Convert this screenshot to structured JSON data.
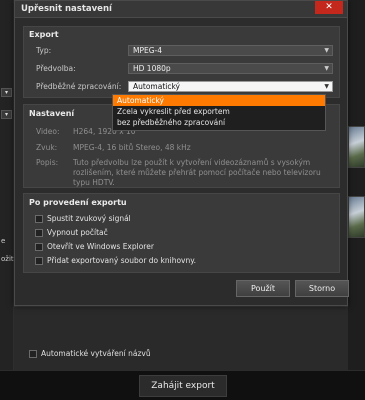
{
  "dialog": {
    "title": "Upřesnit nastavení",
    "close_icon": "close-icon"
  },
  "export_panel": {
    "heading": "Export",
    "type_label": "Typ:",
    "type_value": "MPEG-4",
    "preset_label": "Předvolba:",
    "preset_value": "HD 1080p",
    "prerender_label": "Předběžné zpracování:",
    "prerender_value": "Automatický",
    "prerender_options": [
      "Automatický",
      "Zcela vykreslit před exportem",
      "bez předběžného zpracování"
    ]
  },
  "settings_panel": {
    "heading": "Nastavení",
    "video_label": "Video:",
    "video_value": "H264, 1920 x 10",
    "audio_label": "Zvuk:",
    "audio_value": "MPEG-4, 16 bitů Stereo, 48 kHz",
    "desc_label": "Popis:",
    "desc_value": "Tuto předvolbu lze použít k vytvoření videozáznamů s vysokým rozlišením, které můžete přehrát pomocí počítače nebo televizoru typu HDTV."
  },
  "after_panel": {
    "heading": "Po provedení exportu",
    "options": [
      "Spustit zvukový signál",
      "Vypnout počítač",
      "Otevřít ve Windows Explorer",
      "Přidat exportovaný soubor do knihovny."
    ]
  },
  "buttons": {
    "ok": "Použít",
    "cancel": "Storno"
  },
  "background": {
    "auto_naming": "Automatické vytváření názvů",
    "start_export": "Zahájit export",
    "left_fragment_1": "e",
    "left_fragment_2": "ožit"
  },
  "colors": {
    "accent": "#ff7a00",
    "close": "#c4281c"
  }
}
